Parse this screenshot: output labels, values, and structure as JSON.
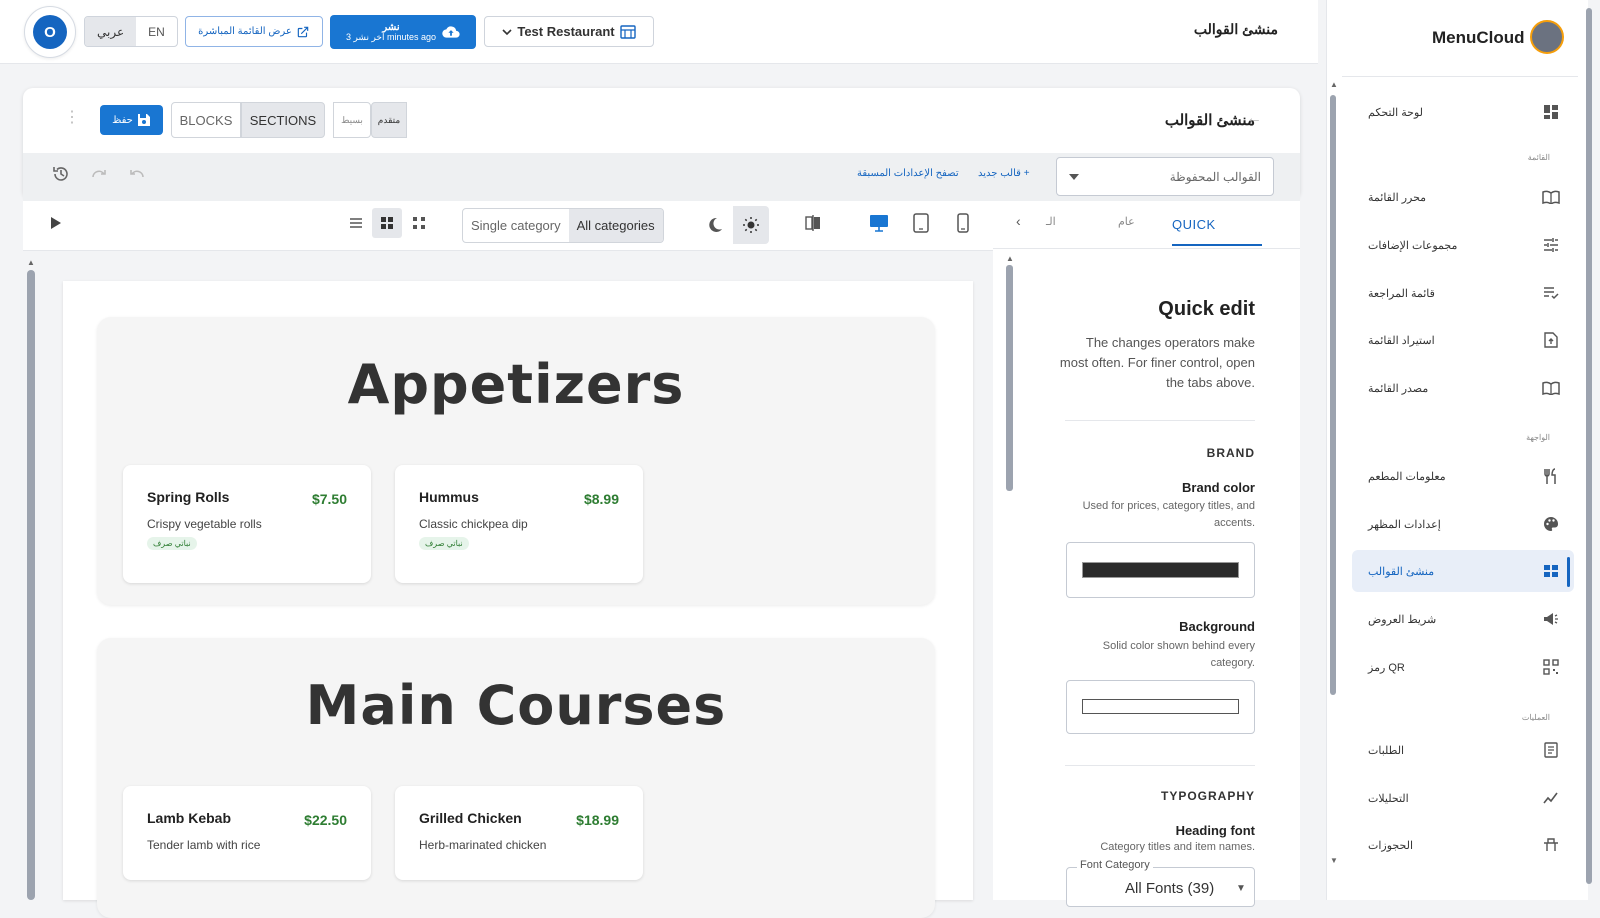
{
  "topbar": {
    "avatar_initial": "O",
    "lang_ar": "عربي",
    "lang_en": "EN",
    "live_menu_label": "عرض القائمة المباشرة",
    "publish_label": "نشر",
    "publish_sub": "آخر نشر 3 minutes ago",
    "restaurant_name": "Test Restaurant",
    "page_title": "منشئ القوالب"
  },
  "sidebar": {
    "brand": "MenuCloud",
    "sections": {
      "menu": "القائمة",
      "storefront": "الواجهة",
      "operations": "العمليات"
    },
    "items": [
      {
        "label": "لوحة التحكم",
        "icon": "dashboard-icon"
      },
      {
        "label": "محرر القائمة",
        "icon": "book-icon"
      },
      {
        "label": "مجموعات الإضافات",
        "icon": "tune-icon"
      },
      {
        "label": "قائمة المراجعة",
        "icon": "checklist-icon"
      },
      {
        "label": "استيراد القائمة",
        "icon": "file-upload-icon"
      },
      {
        "label": "مصدر القائمة",
        "icon": "book-icon"
      },
      {
        "label": "معلومات المطعم",
        "icon": "restaurant-icon"
      },
      {
        "label": "إعدادات المظهر",
        "icon": "palette-icon"
      },
      {
        "label": "منشئ القوالب",
        "icon": "template-icon",
        "active": true
      },
      {
        "label": "شريط العروض",
        "icon": "megaphone-icon"
      },
      {
        "label": "رمز QR",
        "icon": "qr-icon"
      },
      {
        "label": "الطلبات",
        "icon": "receipt-icon"
      },
      {
        "label": "التحليلات",
        "icon": "analytics-icon"
      },
      {
        "label": "الحجوزات",
        "icon": "table-icon"
      }
    ]
  },
  "builder": {
    "title": "منشئ القوالب",
    "mode_advanced": "متقدم",
    "mode_simple": "بسيط",
    "tab_sections": "SECTIONS",
    "tab_blocks": "BLOCKS",
    "save_label": "حفظ",
    "saved_templates_placeholder": "القوالب المحفوظة",
    "new_template": "قالب جديد",
    "browse_presets": "تصفح الإعدادات المسبقة"
  },
  "preview_toolbar": {
    "single_category": "Single category",
    "all_categories": "All categories",
    "selected_view": "grid",
    "selected_theme": "light",
    "selected_device": "desktop"
  },
  "preview": {
    "categories": [
      {
        "title": "Appetizers",
        "items": [
          {
            "name": "Spring Rolls",
            "price": "$7.50",
            "desc": "Crispy vegetable rolls",
            "tag": "نباتي صرف"
          },
          {
            "name": "Hummus",
            "price": "$8.99",
            "desc": "Classic chickpea dip",
            "tag": "نباتي صرف"
          }
        ]
      },
      {
        "title": "Main Courses",
        "items": [
          {
            "name": "Lamb Kebab",
            "price": "$22.50",
            "desc": "Tender lamb with rice"
          },
          {
            "name": "Grilled Chicken",
            "price": "$18.99",
            "desc": "Herb-marinated chicken"
          }
        ]
      }
    ]
  },
  "right_panel": {
    "tabs": {
      "quick": "QUICK",
      "general": "عام",
      "more": "الـ"
    },
    "quick_edit_title": "Quick edit",
    "quick_edit_desc": "The changes operators make most often. For finer control, open the tabs above.",
    "brand_heading": "BRAND",
    "brand_color_label": "Brand color",
    "brand_color_desc": "Used for prices, category titles, and accents.",
    "brand_color_value": "#2b2b2b",
    "background_label": "Background",
    "background_desc": "Solid color shown behind every category.",
    "background_value": "#ffffff",
    "typography_heading": "TYPOGRAPHY",
    "heading_font_label": "Heading font",
    "heading_font_desc": "Category titles and item names.",
    "font_category_legend": "Font Category",
    "font_category_value": "All Fonts (39)"
  },
  "colors": {
    "accent": "#1976d2",
    "price": "#2e7d32",
    "active_nav_bg": "#e8eef8"
  }
}
